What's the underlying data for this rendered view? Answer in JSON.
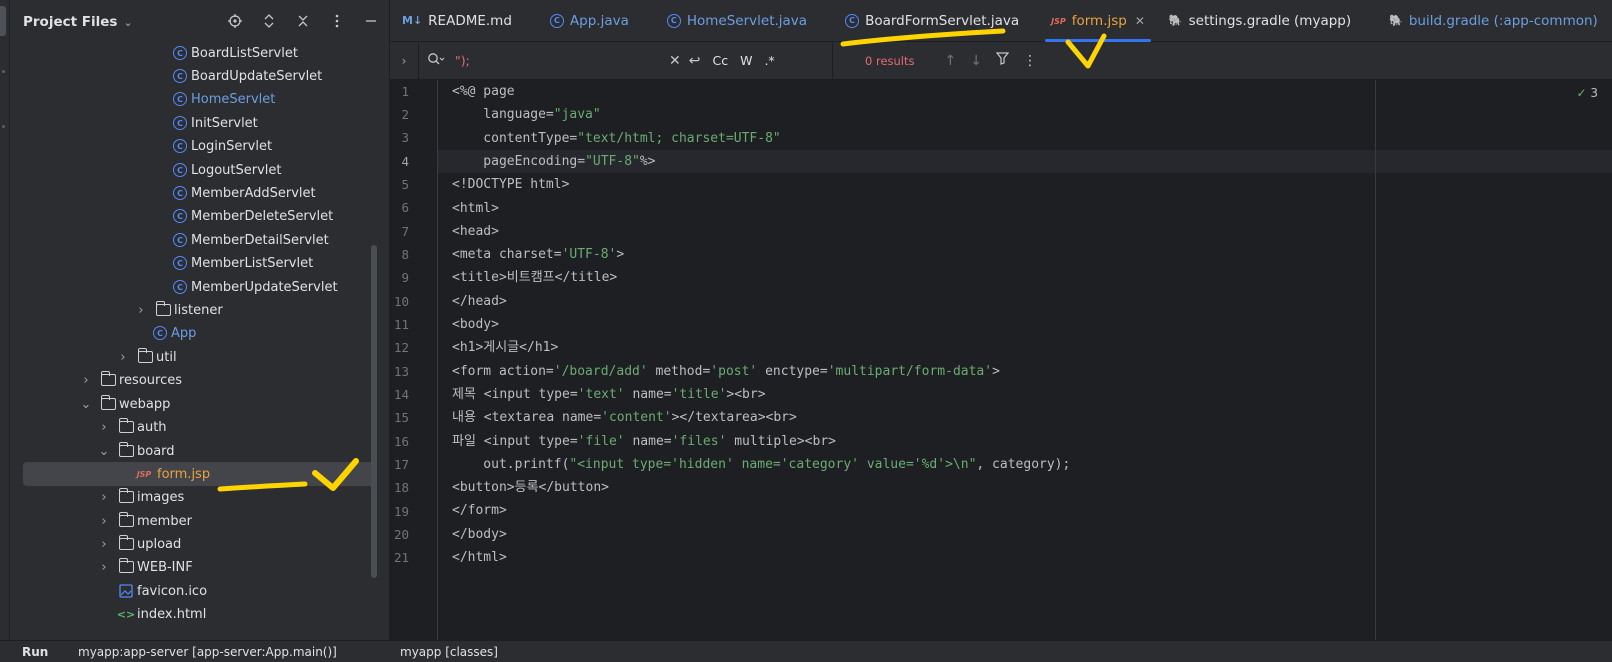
{
  "project_panel": {
    "title": "Project Files",
    "tree": [
      {
        "label": "BoardListServlet",
        "type": "class"
      },
      {
        "label": "BoardUpdateServlet",
        "type": "class"
      },
      {
        "label": "HomeServlet",
        "type": "class"
      },
      {
        "label": "InitServlet",
        "type": "class"
      },
      {
        "label": "LoginServlet",
        "type": "class"
      },
      {
        "label": "LogoutServlet",
        "type": "class"
      },
      {
        "label": "MemberAddServlet",
        "type": "class"
      },
      {
        "label": "MemberDeleteServlet",
        "type": "class"
      },
      {
        "label": "MemberDetailServlet",
        "type": "class"
      },
      {
        "label": "MemberListServlet",
        "type": "class"
      },
      {
        "label": "MemberUpdateServlet",
        "type": "class"
      },
      {
        "label": "listener",
        "type": "package"
      },
      {
        "label": "App",
        "type": "class"
      },
      {
        "label": "util",
        "type": "package"
      },
      {
        "label": "resources",
        "type": "folder"
      },
      {
        "label": "webapp",
        "type": "folder"
      },
      {
        "label": "auth",
        "type": "folder"
      },
      {
        "label": "board",
        "type": "folder"
      },
      {
        "label": "form.jsp",
        "type": "jsp"
      },
      {
        "label": "images",
        "type": "folder"
      },
      {
        "label": "member",
        "type": "folder"
      },
      {
        "label": "upload",
        "type": "folder"
      },
      {
        "label": "WEB-INF",
        "type": "folder"
      },
      {
        "label": "favicon.ico",
        "type": "image"
      },
      {
        "label": "index.html",
        "type": "html"
      }
    ]
  },
  "tabs": [
    {
      "label": "README.md",
      "icon": "markdown-icon"
    },
    {
      "label": "App.java",
      "icon": "class-icon"
    },
    {
      "label": "HomeServlet.java",
      "icon": "class-icon"
    },
    {
      "label": "BoardFormServlet.java",
      "icon": "class-icon"
    },
    {
      "label": "form.jsp",
      "icon": "jsp-icon",
      "active": true
    },
    {
      "label": "settings.gradle (myapp)",
      "icon": "gradle-icon"
    },
    {
      "label": "build.gradle (:app-common)",
      "icon": "gradle-icon"
    }
  ],
  "search": {
    "query": "\");",
    "options": [
      "Cc",
      "W",
      ".*"
    ],
    "results": "0 results"
  },
  "inspection": {
    "count": "3"
  },
  "editor": {
    "current_line": 4,
    "line_numbers": [
      "1",
      "2",
      "3",
      "4",
      "5",
      "6",
      "7",
      "8",
      "9",
      "10",
      "11",
      "12",
      "13",
      "14",
      "15",
      "16",
      "17",
      "18",
      "19",
      "20",
      "21"
    ]
  },
  "bottom": {
    "run_label": "Run",
    "run_config": "myapp:app-server [app-server:App.main()]",
    "run_config2": "myapp [classes]"
  }
}
